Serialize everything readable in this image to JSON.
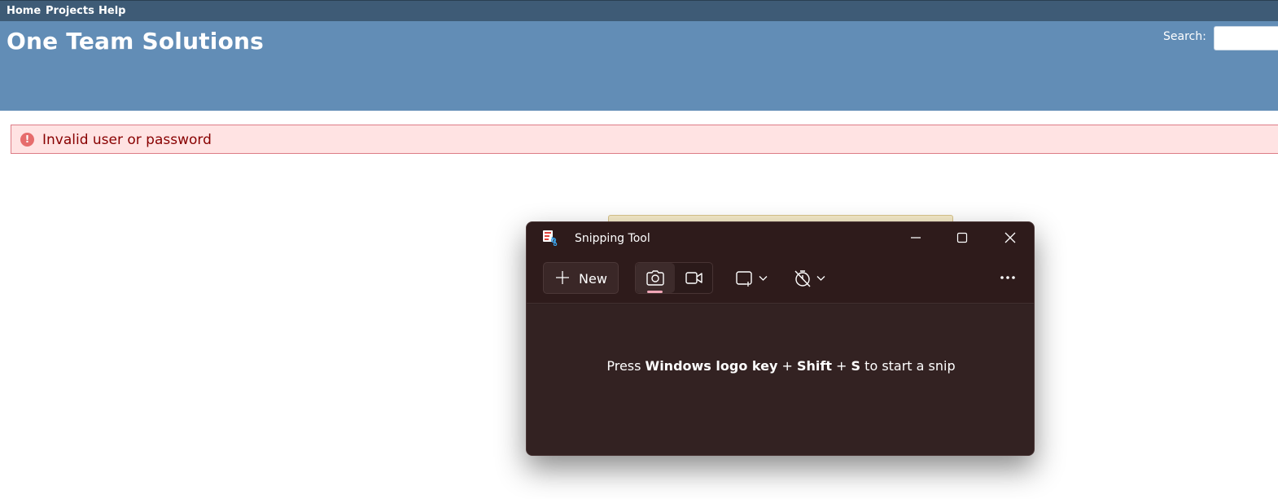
{
  "nav": {
    "items": [
      "Home",
      "Projects",
      "Help"
    ]
  },
  "header": {
    "title": "One Team Solutions",
    "search_label": "Search:",
    "search_value": ""
  },
  "flash": {
    "message": "Invalid user or password"
  },
  "snipping_tool": {
    "title": "Snipping Tool",
    "new_label": "New",
    "hint": {
      "prefix": "Press ",
      "keys": "Windows logo key",
      "plus1": " + ",
      "shift": "Shift",
      "plus2": " + ",
      "s": "S",
      "suffix": " to start a snip"
    },
    "icons": [
      "app-icon",
      "minimize-icon",
      "maximize-icon",
      "close-icon",
      "plus-icon",
      "camera-icon",
      "video-icon",
      "rectangle-snip-icon",
      "chevron-down-icon",
      "timer-off-icon",
      "more-icon"
    ]
  },
  "colors": {
    "nav": "#3e5b76",
    "header": "#628db6",
    "flash_bg": "#ffe3e3",
    "flash_text": "#880000",
    "window_bg": "#2f1f1f",
    "accent": "#f0a6b7"
  }
}
